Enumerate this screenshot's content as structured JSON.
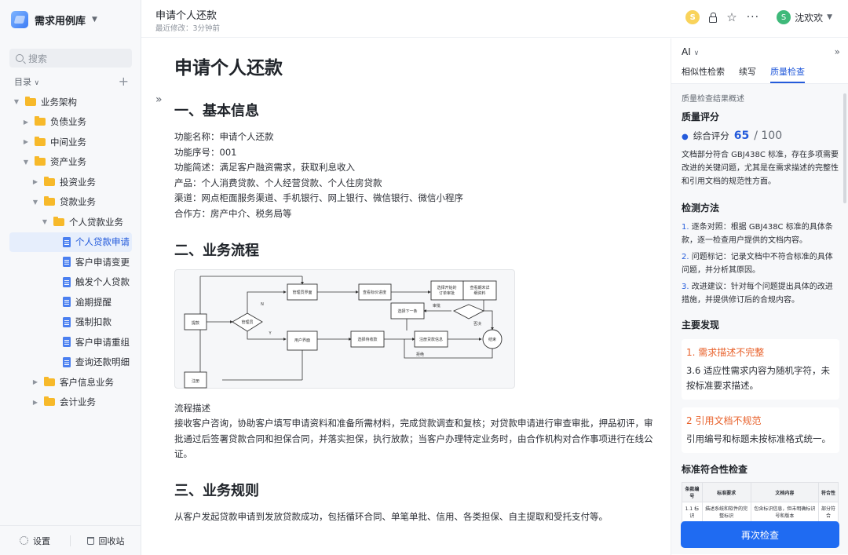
{
  "sidebar": {
    "workspace": "需求用例库",
    "search_placeholder": "搜索",
    "toc_label": "目录",
    "tree": [
      {
        "label": "业务架构",
        "type": "folder",
        "depth": 0,
        "arrow": "down"
      },
      {
        "label": "负债业务",
        "type": "folder",
        "depth": 1,
        "arrow": "right"
      },
      {
        "label": "中间业务",
        "type": "folder",
        "depth": 1,
        "arrow": "right"
      },
      {
        "label": "资产业务",
        "type": "folder",
        "depth": 1,
        "arrow": "down"
      },
      {
        "label": "投资业务",
        "type": "folder",
        "depth": 2,
        "arrow": "right"
      },
      {
        "label": "贷款业务",
        "type": "folder",
        "depth": 2,
        "arrow": "down"
      },
      {
        "label": "个人贷款业务",
        "type": "folder",
        "depth": 3,
        "arrow": "down"
      },
      {
        "label": "个人贷款申请",
        "type": "doc",
        "depth": 4,
        "active": true
      },
      {
        "label": "客户申请变更",
        "type": "doc",
        "depth": 4
      },
      {
        "label": "触发个人贷款",
        "type": "doc",
        "depth": 4
      },
      {
        "label": "逾期提醒",
        "type": "doc",
        "depth": 4
      },
      {
        "label": "强制扣款",
        "type": "doc",
        "depth": 4
      },
      {
        "label": "客户申请重组",
        "type": "doc",
        "depth": 4
      },
      {
        "label": "查询还款明细",
        "type": "doc",
        "depth": 4
      },
      {
        "label": "客户信息业务",
        "type": "folder",
        "depth": 2,
        "arrow": "right"
      },
      {
        "label": "会计业务",
        "type": "folder",
        "depth": 2,
        "arrow": "right"
      }
    ],
    "footer": {
      "settings": "设置",
      "trash": "回收站"
    }
  },
  "header": {
    "title": "申请个人还款",
    "meta": "最近修改：3分钟前",
    "coin_letter": "S",
    "user_initial": "S",
    "user_name": "沈欢欢"
  },
  "doc": {
    "title": "申请个人还款",
    "s1": {
      "heading": "一、基本信息",
      "lines": [
        "功能名称：申请个人还款",
        "功能序号：001",
        "功能简述：满足客户融资需求，获取利息收入",
        "产品：个人消费贷款、个人经营贷款、个人住房贷款",
        "渠道：网点柜面服务渠道、手机银行、网上银行、微信银行、微信小程序",
        "合作方：房产中介、税务局等"
      ]
    },
    "s2": {
      "heading": "二、业务流程",
      "flow_caption": "流程描述",
      "flow_text": "接收客户咨询，协助客户填写申请资料和准备所需材料，完成贷款调查和复核；对贷款申请进行审查审批，押品初评，审批通过后签署贷款合同和担保合同，并落实担保，执行放款；当客户办理特定业务时，由合作机构对合作事项进行在线公证。",
      "diagram": {
        "nodes": [
          "提款",
          "管理员",
          "管理员界面",
          "用户界面",
          "注册",
          "查看标价进度订单",
          "选择待收款",
          "选择开始的订单进行审批处理",
          "查看期末详细资料",
          "选择下一条流入",
          "结束"
        ],
        "edge_labels": [
          "N",
          "Y",
          "审批",
          "否决",
          "拒绝"
        ]
      }
    },
    "s3": {
      "heading": "三、业务规则",
      "text": "从客户发起贷款申请到发放贷款成功，包括循环合同、单笔单批、信用、各类担保、自主提取和受托支付等。"
    }
  },
  "panel": {
    "ai_label": "AI",
    "tabs": [
      "相似性检索",
      "续写",
      "质量检查"
    ],
    "active_tab": 2,
    "overview": "质量检查结果概述",
    "score_title": "质量评分",
    "score_label": "综合评分",
    "score_value": "65",
    "score_total": "/ 100",
    "summary": "文档部分符合 GBJ438C 标准，存在多项需要改进的关键问题，尤其是在需求描述的完整性和引用文档的规范性方面。",
    "method_title": "检测方法",
    "methods": [
      {
        "num": "1.",
        "text": "逐条对照：根据 GBJ438C 标准的具体条款，逐一检查用户提供的文档内容。"
      },
      {
        "num": "2.",
        "text": "问题标记：记录文档中不符合标准的具体问题，并分析其原因。"
      },
      {
        "num": "3.",
        "text": "改进建议：针对每个问题提出具体的改进措施，并提供修订后的合规内容。"
      }
    ],
    "findings_title": "主要发现",
    "findings": [
      {
        "title": "1. 需求描述不完整",
        "body": "3.6 适应性需求内容为随机字符，未按标准要求描述。"
      },
      {
        "title": "2 引用文档不规范",
        "body": "引用编号和标题未按标准格式统一。"
      }
    ],
    "compliance_title": "标准符合性检查",
    "table": {
      "headers": [
        "条款编号",
        "标准要求",
        "文档内容",
        "符合性"
      ],
      "rows": [
        [
          "1.1 标识",
          "描述系统和软件的完整标识",
          "包含标识信息，但未明确标识号和版本",
          "部分符合"
        ]
      ]
    },
    "recheck_label": "再次检查"
  },
  "colors": {
    "accent": "#245bdb",
    "button": "#1f6bf2",
    "warning": "#e8612b",
    "folder": "#f7b92a"
  }
}
